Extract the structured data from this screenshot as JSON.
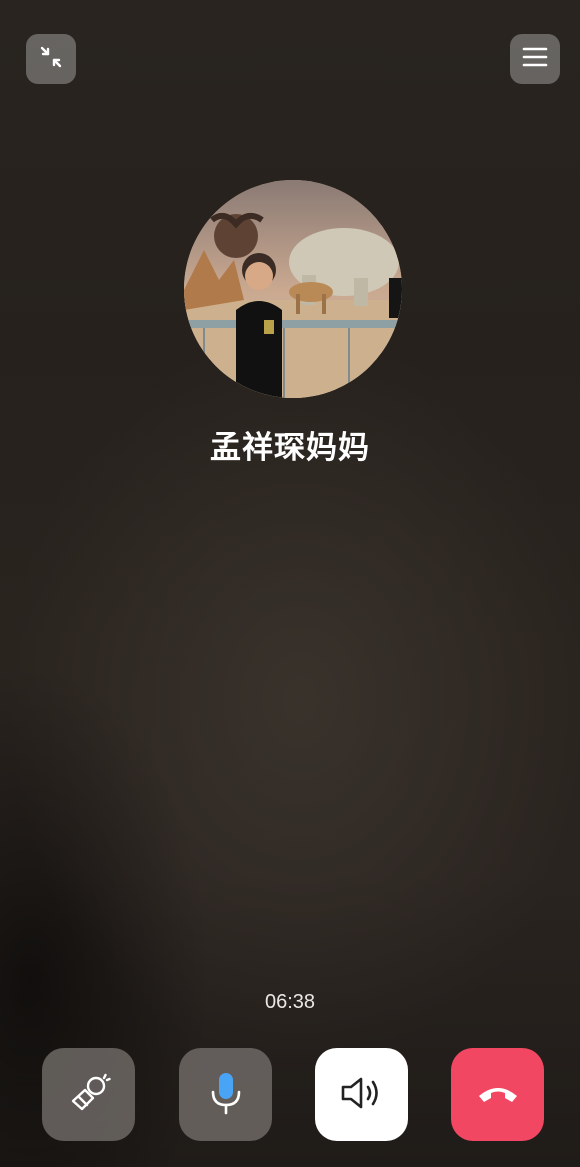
{
  "call": {
    "caller_name": "孟祥琛妈妈",
    "duration": "06:38"
  },
  "icons": {
    "minimize": "minimize-icon",
    "menu": "menu-icon",
    "effects": "magic-wand-icon",
    "microphone": "microphone-icon",
    "speaker": "speaker-icon",
    "hangup": "hangup-icon"
  },
  "colors": {
    "hangup": "#f24762",
    "mic_accent": "#4aa4f6",
    "speaker_button": "#ffffff"
  }
}
